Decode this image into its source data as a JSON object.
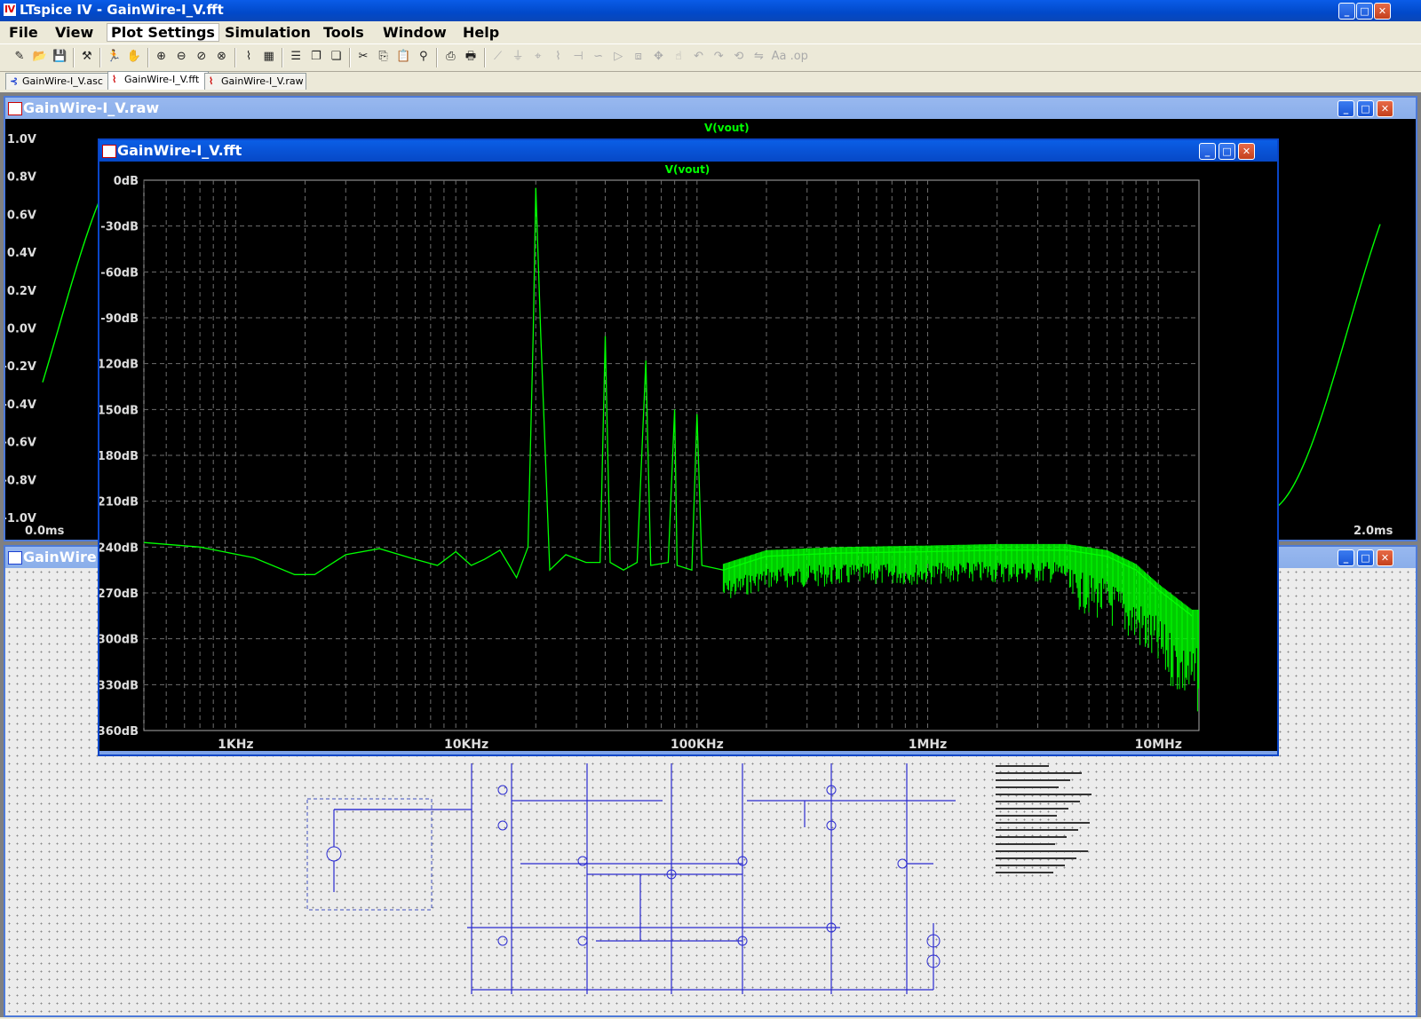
{
  "app": {
    "title": "LTspice IV - GainWire-I_V.fft",
    "window_buttons": {
      "minimize": "_",
      "maximize": "□",
      "close": "✕"
    }
  },
  "menu": [
    "File",
    "View",
    "Plot Settings",
    "Simulation",
    "Tools",
    "Window",
    "Help"
  ],
  "toolbar_icons": [
    "new-schematic-icon",
    "open-icon",
    "save-icon",
    "control-panel-icon",
    "run-icon",
    "halt-icon",
    "zoom-in-icon",
    "zoom-out-icon",
    "zoom-back-icon",
    "zoom-fit-icon",
    "autorange-icon",
    "add-plot-icon",
    "tile-icon",
    "cascade-icon",
    "stack-icon",
    "cut-icon",
    "copy-icon",
    "paste-icon",
    "find-icon",
    "print-setup-icon",
    "print-icon",
    "wire-icon",
    "ground-icon",
    "label-icon",
    "resistor-icon",
    "capacitor-icon",
    "inductor-icon",
    "diode-icon",
    "component-icon",
    "move-icon",
    "drag-icon",
    "undo-icon",
    "redo-icon",
    "rotate-icon",
    "mirror-icon",
    "text-icon",
    "spice-directive-icon"
  ],
  "tabs": [
    {
      "label": "GainWire-I_V.asc",
      "icon": "schematic-icon"
    },
    {
      "label": "GainWire-I_V.fft",
      "icon": "waveform-icon",
      "selected": true
    },
    {
      "label": "GainWire-I_V.raw",
      "icon": "waveform-icon"
    }
  ],
  "raw_window": {
    "title": "GainWire-I_V.raw",
    "trace": "V(vout)",
    "y_ticks": [
      "1.0V",
      "0.8V",
      "0.6V",
      "0.4V",
      "0.2V",
      "0.0V",
      "-0.2V",
      "-0.4V",
      "-0.6V",
      "-0.8V",
      "-1.0V"
    ],
    "x_start": "0.0ms",
    "x_end": "2.0ms"
  },
  "schematic_window": {
    "title": "GainWire-I_V.asc",
    "title_visible": "GainWire"
  },
  "fft_window": {
    "title": "GainWire-I_V.fft",
    "trace_color": "#00ff00"
  },
  "colors": {
    "grid": "#6e6e6e",
    "trace": "#00ff00",
    "wire": "#2a2ad0",
    "titlebar": "#0a52d8"
  },
  "chart_data": {
    "type": "line",
    "title": "V(vout)",
    "xlabel": "",
    "ylabel": "",
    "x_scale": "log",
    "xlim": [
      400,
      15000000
    ],
    "ylim": [
      -360,
      0
    ],
    "x_tick_labels": [
      "1KHz",
      "10KHz",
      "100KHz",
      "1MHz",
      "10MHz"
    ],
    "x_tick_values": [
      1000,
      10000,
      100000,
      1000000,
      10000000
    ],
    "y_tick_labels": [
      "0dB",
      "-30dB",
      "-60dB",
      "-90dB",
      "-120dB",
      "-150dB",
      "-180dB",
      "-210dB",
      "-240dB",
      "-270dB",
      "-300dB",
      "-330dB",
      "-360dB"
    ],
    "y_tick_values": [
      0,
      -30,
      -60,
      -90,
      -120,
      -150,
      -180,
      -210,
      -240,
      -270,
      -300,
      -330,
      -360
    ],
    "grid": true,
    "series": [
      {
        "name": "V(vout)",
        "x": [
          400,
          700,
          1200,
          1800,
          2200,
          3000,
          4200,
          6000,
          7500,
          9000,
          10500,
          12000,
          14000,
          16500,
          18500,
          19500,
          20000,
          21000,
          23000,
          27000,
          33000,
          38000,
          40000,
          42000,
          48000,
          55000,
          60000,
          63000,
          75000,
          80000,
          82000,
          95000,
          100000,
          105000,
          130000,
          200000,
          400000,
          1000000,
          2000000,
          4000000,
          6000000,
          8000000,
          10000000,
          14000000
        ],
        "y": [
          -237,
          -240,
          -247,
          -258,
          -258,
          -245,
          -241,
          -248,
          -252,
          -243,
          -252,
          -248,
          -242,
          -260,
          -240,
          -100,
          -5,
          -100,
          -255,
          -245,
          -250,
          -250,
          -102,
          -250,
          -255,
          -250,
          -118,
          -252,
          -250,
          -150,
          -252,
          -255,
          -153,
          -252,
          -255,
          -246,
          -244,
          -243,
          -242,
          -242,
          -246,
          -255,
          -268,
          -285
        ]
      }
    ],
    "raw_series": {
      "type": "line",
      "name": "V(vout)",
      "x_unit": "ms",
      "xlim": [
        0,
        2
      ],
      "ylim": [
        -1,
        1
      ],
      "amplitude": 0.97,
      "frequency_hz": 20000
    }
  }
}
